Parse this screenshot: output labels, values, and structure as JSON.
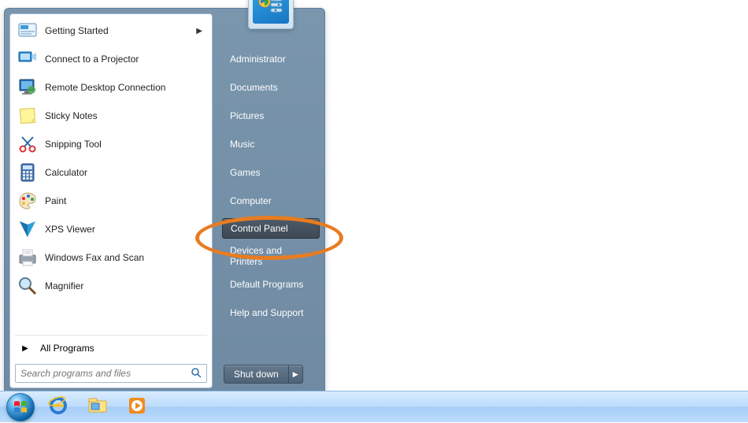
{
  "avatar": {
    "icon_name": "control-panel-icon"
  },
  "programs": [
    {
      "label": "Getting Started",
      "icon": "getting-started-icon",
      "has_submenu": true
    },
    {
      "label": "Connect to a Projector",
      "icon": "projector-icon",
      "has_submenu": false
    },
    {
      "label": "Remote Desktop Connection",
      "icon": "remote-desktop-icon",
      "has_submenu": false
    },
    {
      "label": "Sticky Notes",
      "icon": "sticky-notes-icon",
      "has_submenu": false
    },
    {
      "label": "Snipping Tool",
      "icon": "snipping-tool-icon",
      "has_submenu": false
    },
    {
      "label": "Calculator",
      "icon": "calculator-icon",
      "has_submenu": false
    },
    {
      "label": "Paint",
      "icon": "paint-icon",
      "has_submenu": false
    },
    {
      "label": "XPS Viewer",
      "icon": "xps-viewer-icon",
      "has_submenu": false
    },
    {
      "label": "Windows Fax and Scan",
      "icon": "fax-scan-icon",
      "has_submenu": false
    },
    {
      "label": "Magnifier",
      "icon": "magnifier-icon",
      "has_submenu": false
    }
  ],
  "all_programs_label": "All Programs",
  "search": {
    "placeholder": "Search programs and files"
  },
  "right_items": [
    {
      "label": "Administrator",
      "highlighted": false
    },
    {
      "label": "Documents",
      "highlighted": false
    },
    {
      "label": "Pictures",
      "highlighted": false
    },
    {
      "label": "Music",
      "highlighted": false
    },
    {
      "label": "Games",
      "highlighted": false
    },
    {
      "label": "Computer",
      "highlighted": false
    },
    {
      "label": "Control Panel",
      "highlighted": true
    },
    {
      "label": "Devices and Printers",
      "highlighted": false
    },
    {
      "label": "Default Programs",
      "highlighted": false
    },
    {
      "label": "Help and Support",
      "highlighted": false
    }
  ],
  "shutdown": {
    "label": "Shut down"
  },
  "taskbar": {
    "items": [
      {
        "name": "start-orb",
        "icon": "windows-logo-icon"
      },
      {
        "name": "internet-explorer",
        "icon": "ie-icon"
      },
      {
        "name": "file-explorer",
        "icon": "explorer-icon"
      },
      {
        "name": "media-player",
        "icon": "media-player-icon"
      }
    ]
  },
  "annotation": {
    "highlighted_item": "Control Panel",
    "color": "#e87c20"
  }
}
